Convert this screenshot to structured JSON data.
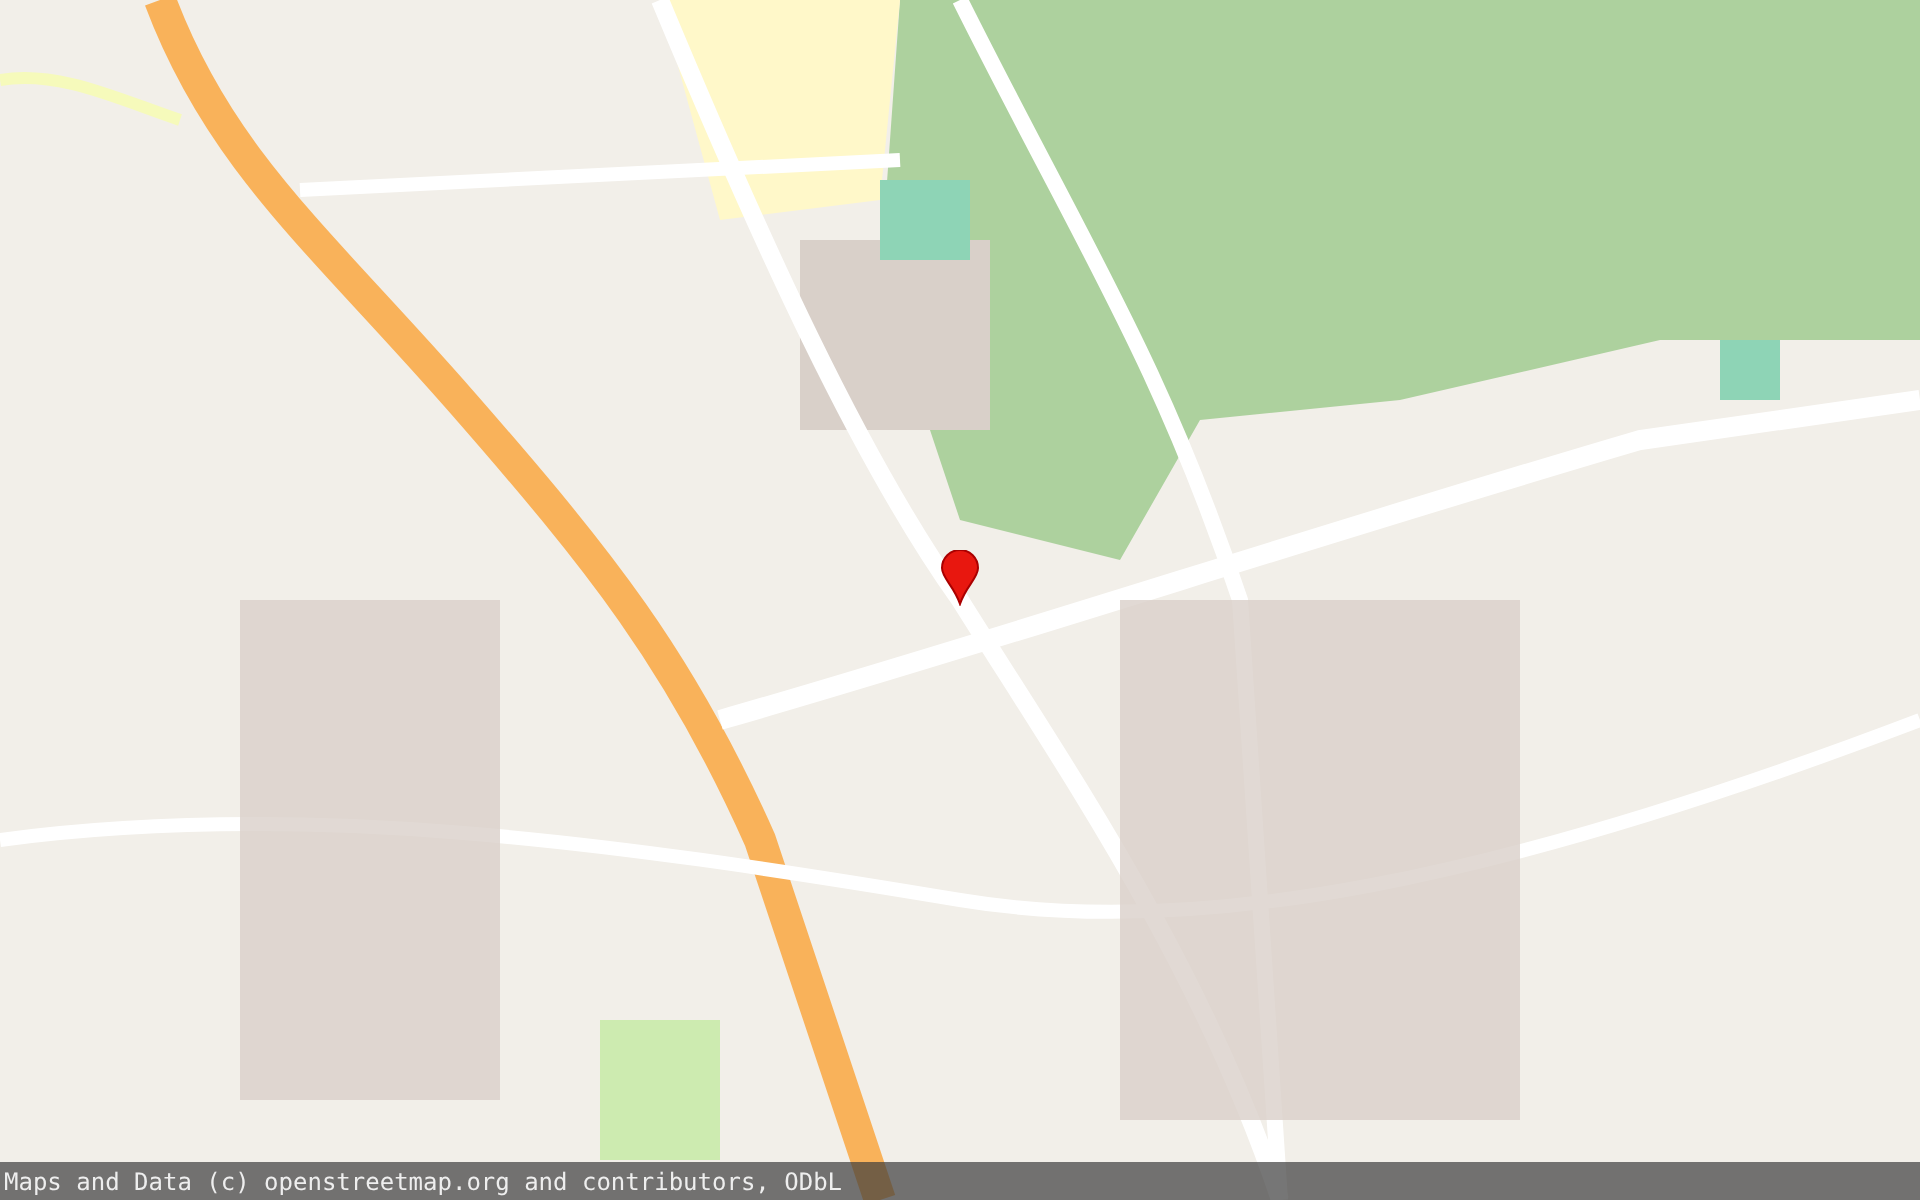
{
  "map": {
    "attribution": "Maps and Data (c) openstreetmap.org and contributors, ODbL"
  }
}
